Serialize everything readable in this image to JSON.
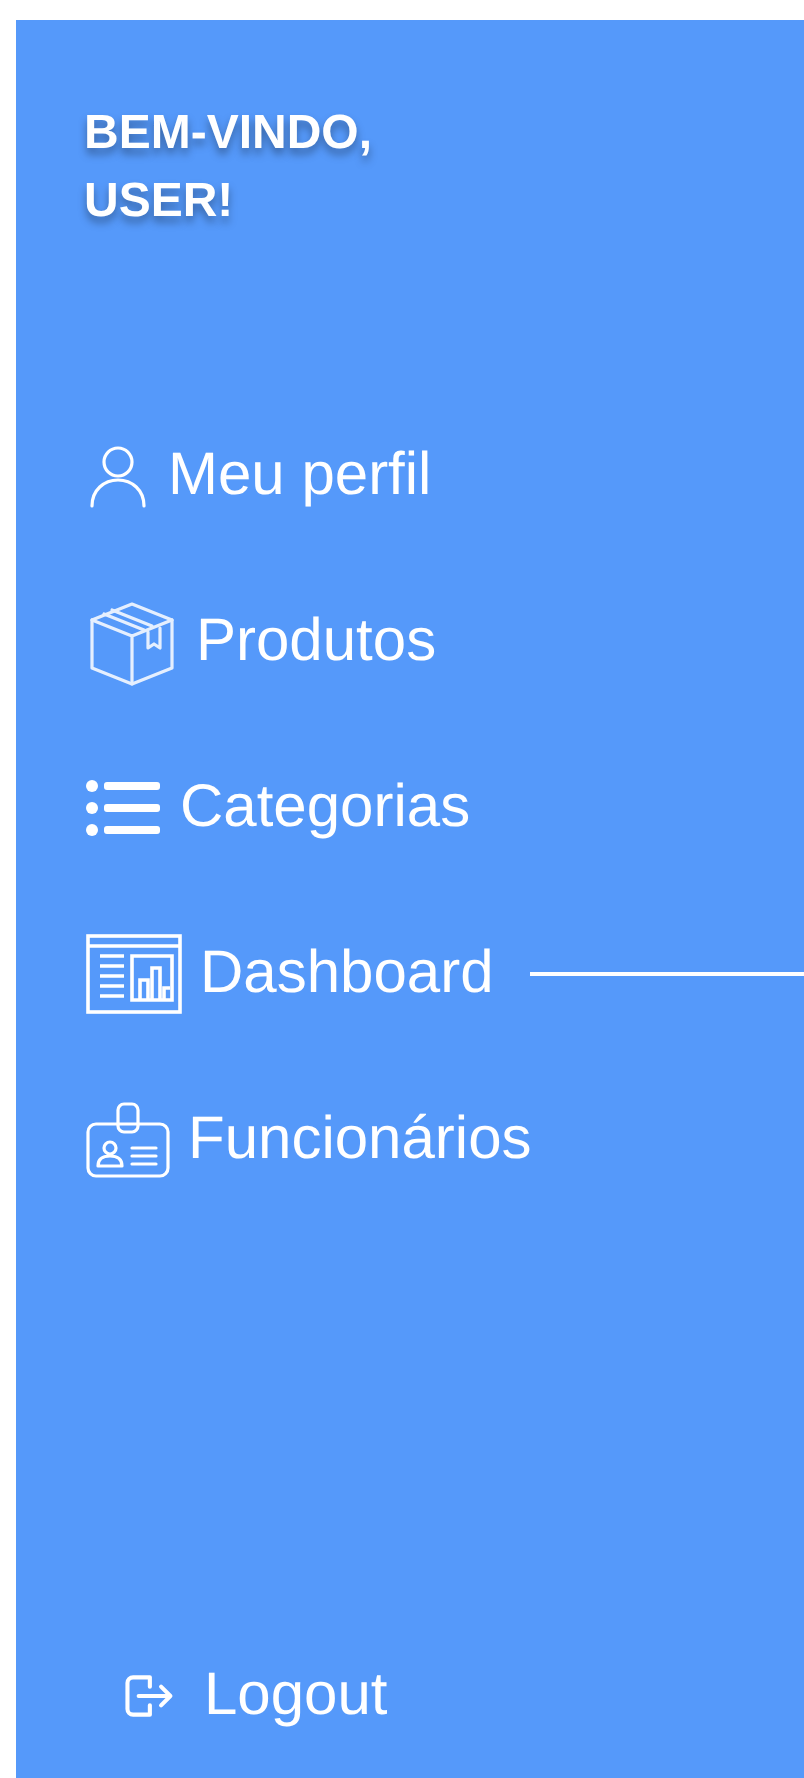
{
  "sidebar": {
    "greeting": "BEM-VINDO,\nUSER!",
    "items": [
      {
        "label": "Meu perfil",
        "selected": false
      },
      {
        "label": "Produtos",
        "selected": false
      },
      {
        "label": "Categorias",
        "selected": false
      },
      {
        "label": "Dashboard",
        "selected": true
      },
      {
        "label": "Funcionários",
        "selected": false
      }
    ],
    "logout": {
      "label": "Logout"
    }
  }
}
